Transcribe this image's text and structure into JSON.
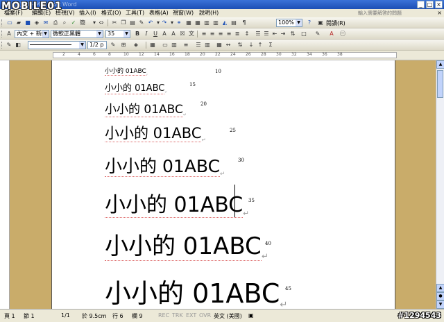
{
  "watermark": "MOBILE01",
  "window": {
    "title": "文件1 - Microsoft Word",
    "minimize": "_",
    "maximize": "□",
    "close": "×"
  },
  "menu": [
    "檔案(F)",
    "編輯(E)",
    "檢視(V)",
    "插入(I)",
    "格式(O)",
    "工具(T)",
    "表格(A)",
    "視窗(W)",
    "說明(H)"
  ],
  "help_placeholder": "輸入需要解答的問題",
  "toolbar1": {
    "zoom": "100%",
    "reading": "閱讀(R)"
  },
  "toolbar2": {
    "style": "內文 + 新細明",
    "font": "微軟正黑體",
    "size": "35",
    "bold": "B",
    "italic": "I",
    "underline": "U"
  },
  "toolbar3": {
    "page": "1/2 p"
  },
  "ruler": [
    "2",
    "4",
    "6",
    "8",
    "10",
    "12",
    "14",
    "16",
    "18",
    "20",
    "22",
    "24",
    "26",
    "28",
    "30",
    "32",
    "34",
    "36",
    "38"
  ],
  "document": {
    "lines": [
      {
        "text": "小小的 01ABC",
        "size": "10"
      },
      {
        "text": "小小的 01ABC",
        "size": "15"
      },
      {
        "text": "小小的 01ABC",
        "size": "20"
      },
      {
        "text": "小小的 01ABC",
        "size": "25"
      },
      {
        "text": "小小的 01ABC",
        "size": "30"
      },
      {
        "text": "小小的 01ABC",
        "size": "35"
      },
      {
        "text": "小小的 01ABC",
        "size": "40"
      },
      {
        "text": "小小的 01ABC",
        "size": "45"
      }
    ],
    "para_mark": "↵"
  },
  "status": {
    "page": "頁 1",
    "section": "節 1",
    "pages": "1/1",
    "at": "於 9.5cm",
    "line": "行 6",
    "col": "欄 9",
    "rec": "REC",
    "trk": "TRK",
    "ext": "EXT",
    "ovr": "OVR",
    "lang": "英文 (美國)"
  },
  "photo_id": "#1294543"
}
